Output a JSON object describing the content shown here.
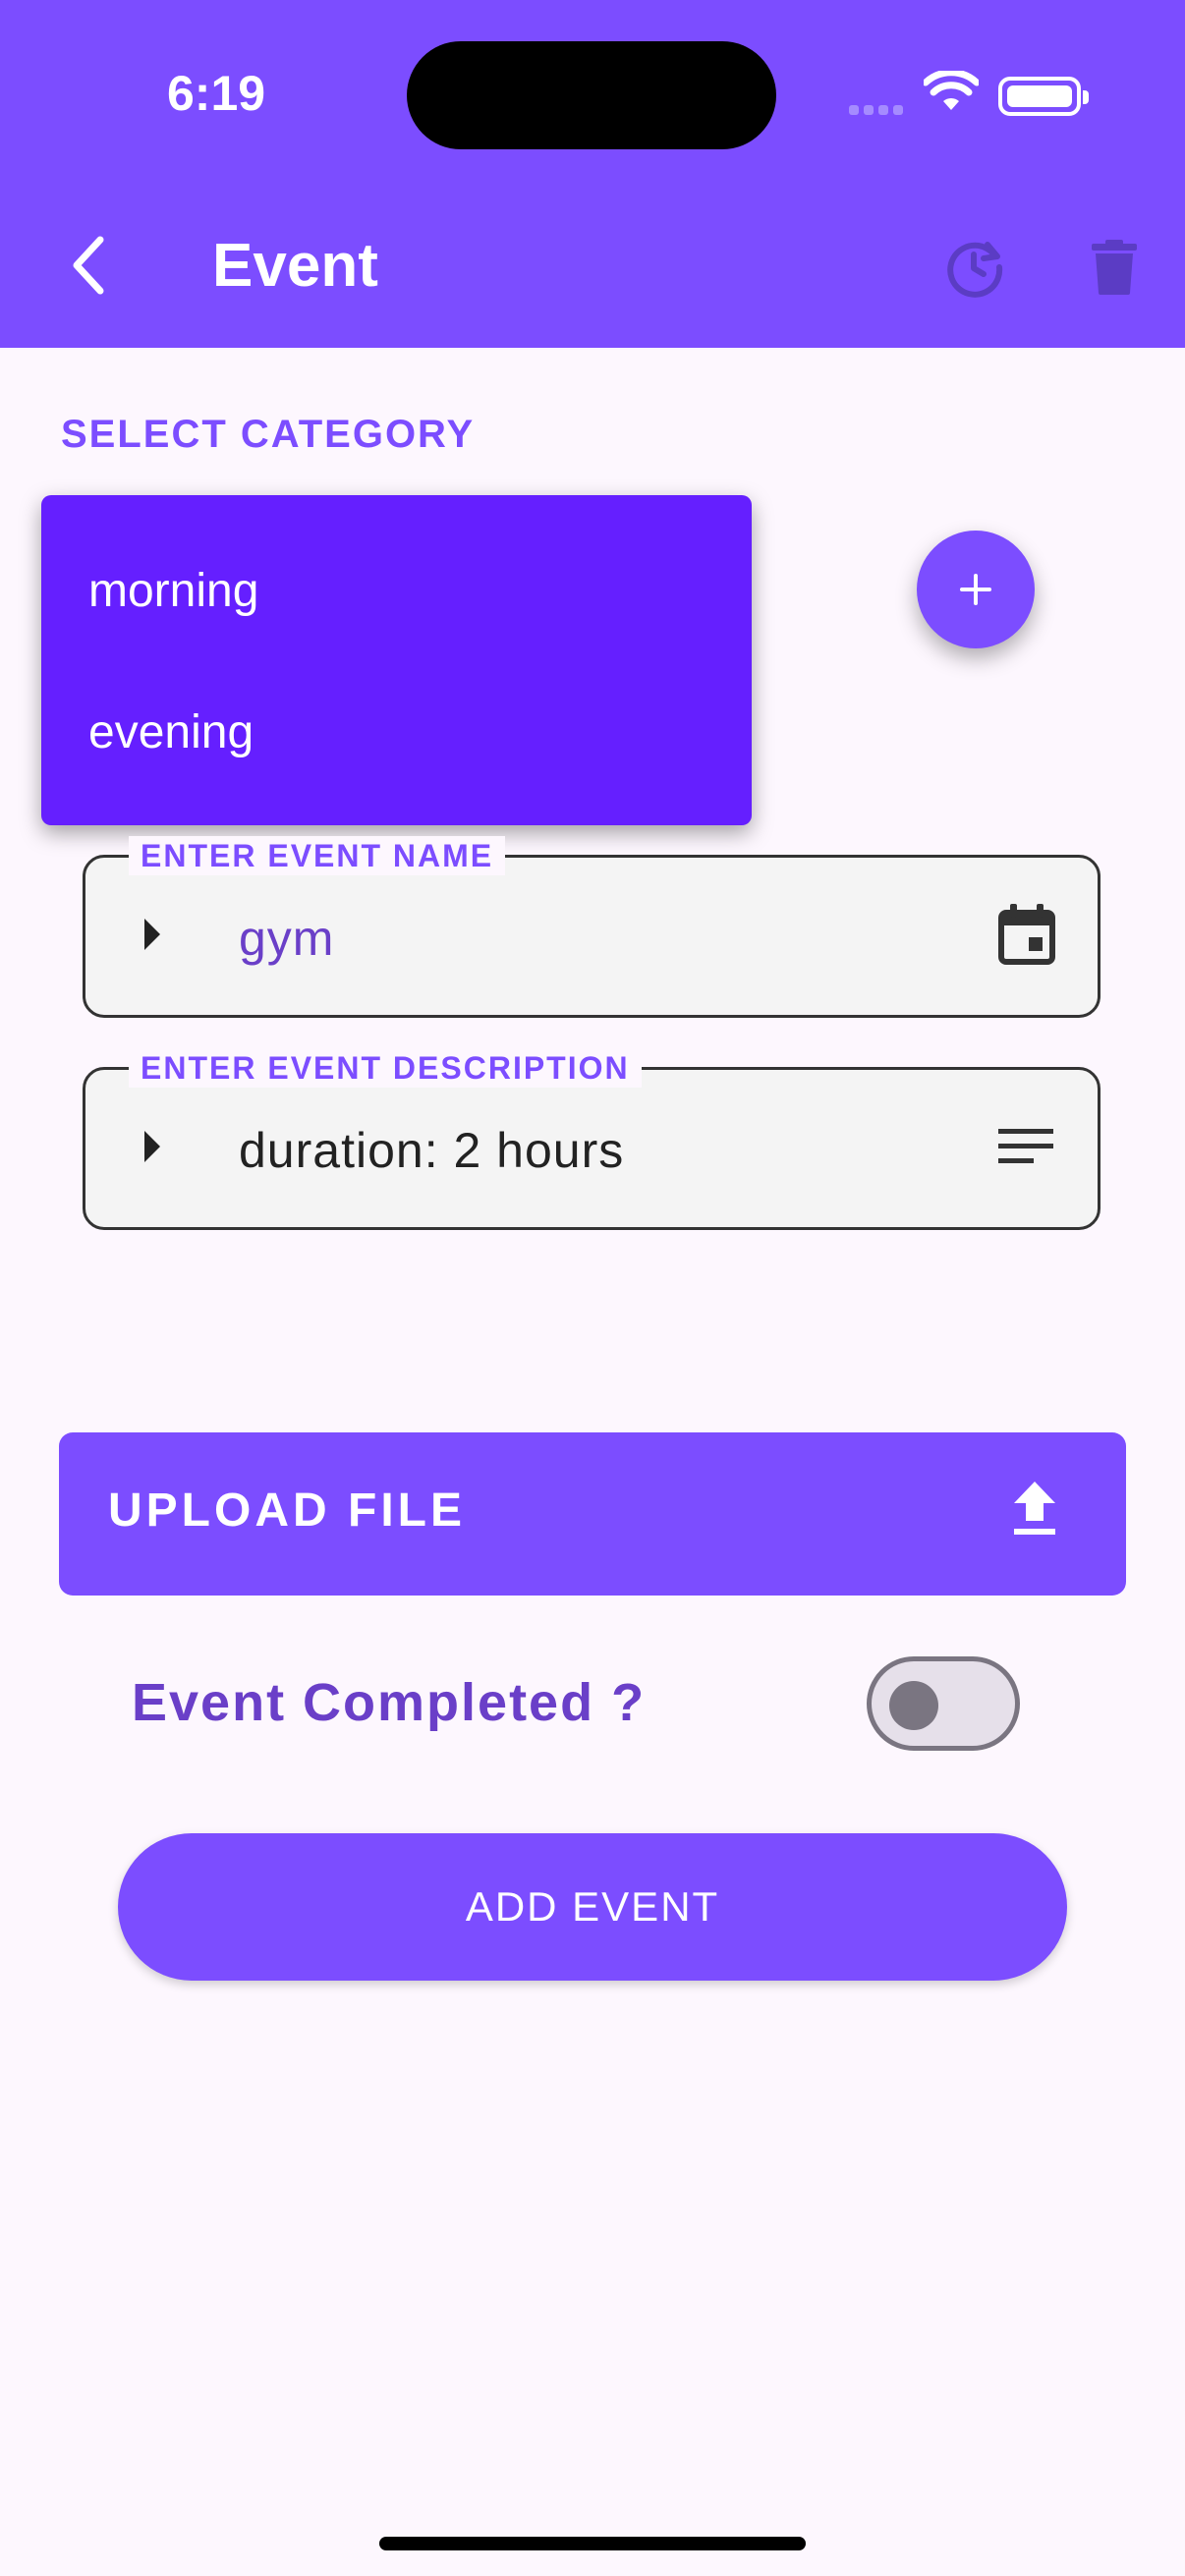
{
  "status_bar": {
    "time": "6:19"
  },
  "app_bar": {
    "title": "Event",
    "icons": [
      "back-chevron-icon",
      "history-icon",
      "trash-icon"
    ]
  },
  "category": {
    "label": "SELECT CATEGORY",
    "options": [
      "morning",
      "evening"
    ]
  },
  "fields": {
    "event_name": {
      "label": "ENTER EVENT NAME",
      "value": "gym",
      "icon": "calendar-icon"
    },
    "event_description": {
      "label": "ENTER EVENT DESCRIPTION",
      "value": "duration: 2 hours",
      "icon": "notes-icon"
    }
  },
  "upload": {
    "label": "UPLOAD FILE",
    "icon": "upload-icon"
  },
  "completed": {
    "label": "Event Completed ?",
    "checked": false
  },
  "add_button": {
    "label": "ADD EVENT"
  },
  "colors": {
    "primary": "#7c4dff",
    "dropdown": "#651fff",
    "background": "#fdf7fe",
    "label_purple": "#6a3fc8"
  }
}
